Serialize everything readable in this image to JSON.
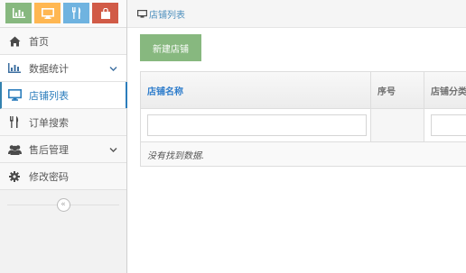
{
  "shortcuts": {
    "colors": [
      "#87b87f",
      "#ffb752",
      "#6fb3e0",
      "#d15b47"
    ],
    "icons": [
      "bar-chart-icon",
      "desktop-icon",
      "cutlery-icon",
      "shopping-bag-icon"
    ]
  },
  "sidebar": {
    "items": [
      {
        "label": "首页",
        "icon": "home-icon"
      },
      {
        "label": "数据统计",
        "icon": "bar-chart-icon"
      },
      {
        "label": "店铺列表",
        "icon": "desktop-icon"
      },
      {
        "label": "订单搜索",
        "icon": "cutlery-icon"
      },
      {
        "label": "售后管理",
        "icon": "users-icon"
      },
      {
        "label": "修改密码",
        "icon": "gear-icon"
      }
    ],
    "collapse_glyph": "«"
  },
  "breadcrumb": {
    "label": "店铺列表"
  },
  "toolbar": {
    "add_label": "新建店铺"
  },
  "table": {
    "headers": [
      "店铺名称",
      "序号",
      "店铺分类"
    ],
    "empty_text": "没有找到数据."
  },
  "colors": {
    "accent": "#2b7dbc",
    "add_button": "#87b87f"
  }
}
